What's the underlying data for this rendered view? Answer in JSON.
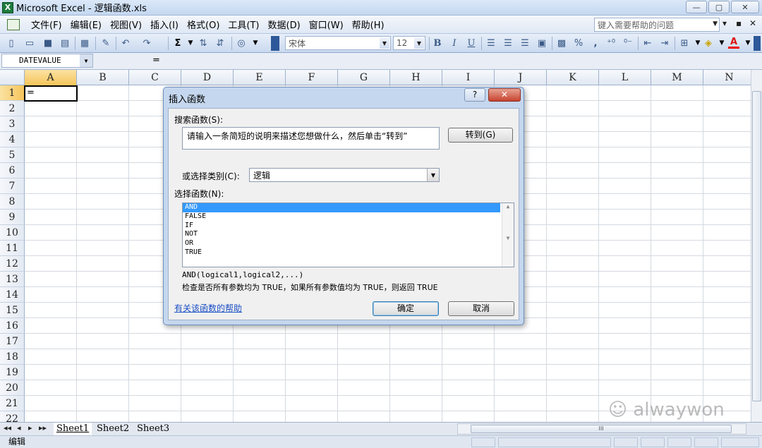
{
  "window": {
    "app_icon": "X",
    "title": "Microsoft Excel - 逻辑函数.xls",
    "controls": [
      "—",
      "▢",
      "✕"
    ]
  },
  "menu": {
    "items": [
      "文件(F)",
      "编辑(E)",
      "视图(V)",
      "插入(I)",
      "格式(O)",
      "工具(T)",
      "数据(D)",
      "窗口(W)",
      "帮助(H)"
    ],
    "help_placeholder": "键入需要帮助的问题",
    "right_controls": [
      "▾",
      "▪",
      "✕"
    ]
  },
  "toolbar": {
    "font_name": "宋体",
    "font_size": "12",
    "sum_symbol": "Σ",
    "bold": "B",
    "italic": "I",
    "underline": "U",
    "percent": "%",
    "comma": ","
  },
  "formula_bar": {
    "name_box": "DATEVALUE",
    "content": "="
  },
  "sheet": {
    "columns": [
      "A",
      "B",
      "C",
      "D",
      "E",
      "F",
      "G",
      "H",
      "I",
      "J",
      "K",
      "L",
      "M",
      "N"
    ],
    "rows": [
      "1",
      "2",
      "3",
      "4",
      "5",
      "6",
      "7",
      "8",
      "9",
      "10",
      "11",
      "12",
      "13",
      "14",
      "15",
      "16",
      "17",
      "18",
      "19",
      "20",
      "21",
      "22"
    ],
    "selected_column": "A",
    "selected_row": "1",
    "active_cell_value": "="
  },
  "tabs": {
    "nav": [
      "◂◂",
      "◂",
      "▸",
      "▸▸"
    ],
    "sheets": [
      "Sheet1",
      "Sheet2",
      "Sheet3"
    ],
    "active": "Sheet1",
    "scroll_grip": "III"
  },
  "status": {
    "mode": "编辑"
  },
  "watermark": "alwaywon",
  "dialog": {
    "title": "插入函数",
    "help_button": "?",
    "close_button": "✕",
    "search_label": "搜索函数(S):",
    "search_text": "请输入一条简短的说明来描述您想做什么，然后单击“转到”",
    "go_button": "转到(G)",
    "category_label": "或选择类别(C):",
    "category_value": "逻辑",
    "function_label": "选择函数(N):",
    "functions": [
      "AND",
      "FALSE",
      "IF",
      "NOT",
      "OR",
      "TRUE"
    ],
    "selected_function": "AND",
    "signature": "AND(logical1,logical2,...)",
    "description": "检查是否所有参数均为 TRUE，如果所有参数值均为 TRUE，则返回 TRUE",
    "help_link": "有关该函数的帮助",
    "ok_button": "确定",
    "cancel_button": "取消"
  }
}
